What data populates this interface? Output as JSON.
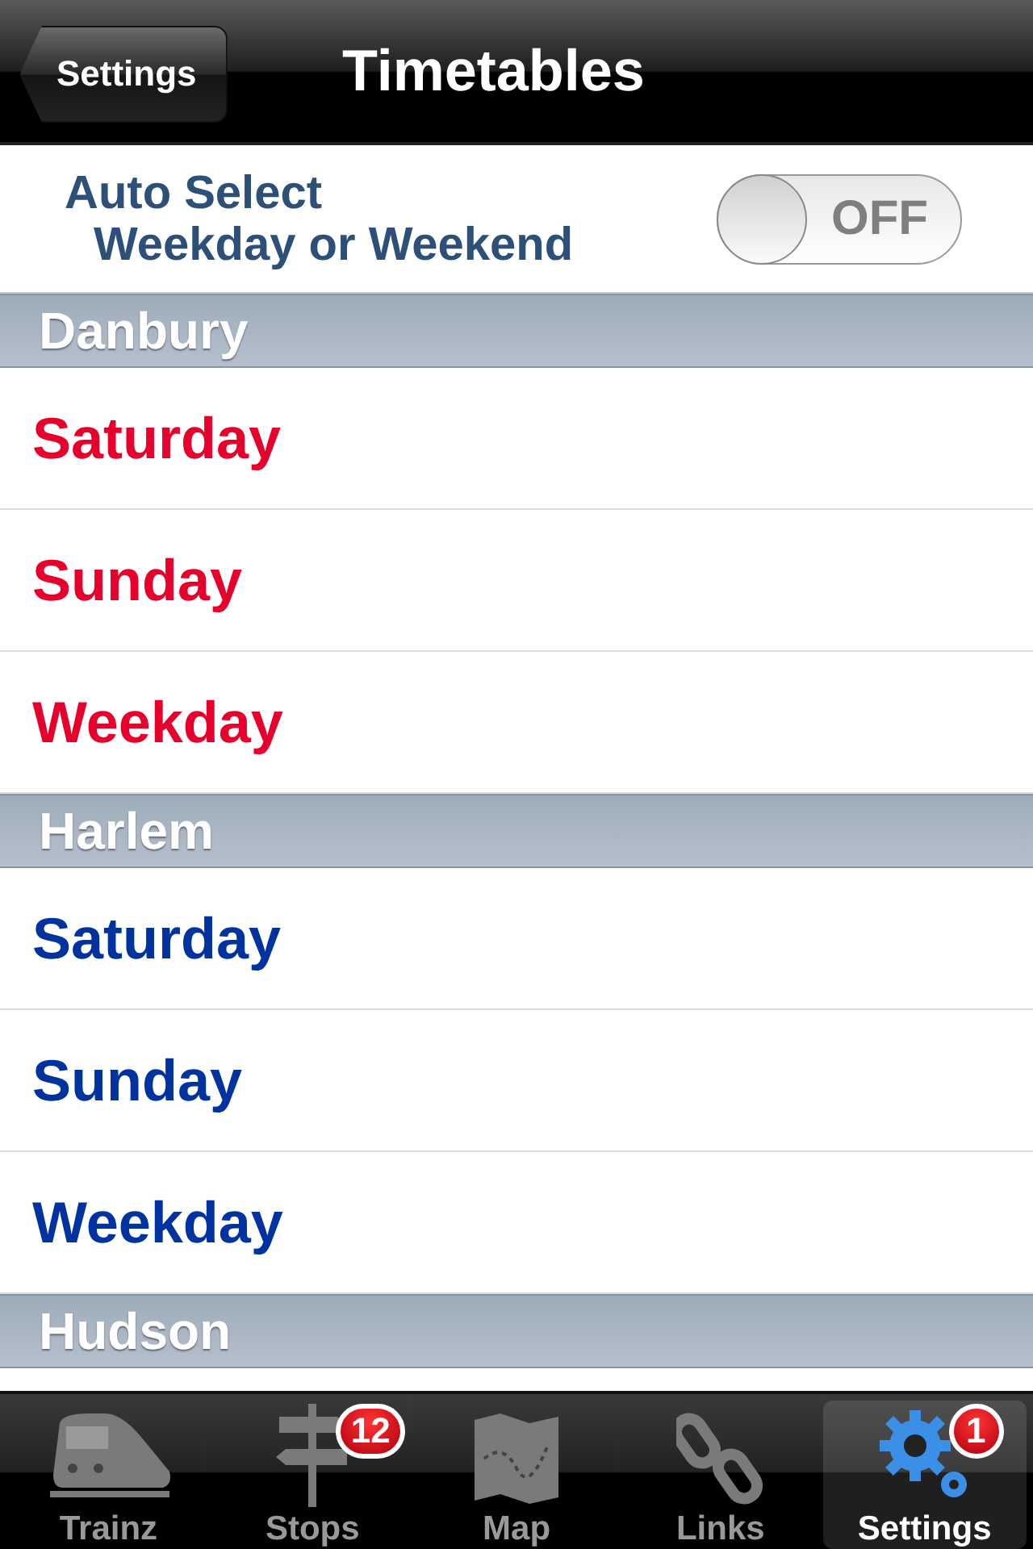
{
  "nav_bar": {
    "back_button": "Settings",
    "title": "Timetables"
  },
  "auto_select": {
    "label_line_1": "Auto Select",
    "label_line_2": "Weekday or Weekend",
    "switch": {
      "on": false,
      "text": "OFF"
    }
  },
  "sections": [
    {
      "header": "Danbury",
      "color": "#e8002d",
      "rows": [
        "Saturday",
        "Sunday",
        "Weekday"
      ]
    },
    {
      "header": "Harlem",
      "color": "#0033a0",
      "rows": [
        "Saturday",
        "Sunday",
        "Weekday"
      ]
    },
    {
      "header": "Hudson"
    }
  ],
  "tab_bar": [
    {
      "label": "Trainz",
      "selected": false
    },
    {
      "label": "Stops",
      "selected": false,
      "badge": "12"
    },
    {
      "label": "Map",
      "selected": false
    },
    {
      "label": "Links",
      "selected": false
    },
    {
      "label": "Settings",
      "selected": true,
      "badge": "1"
    }
  ]
}
